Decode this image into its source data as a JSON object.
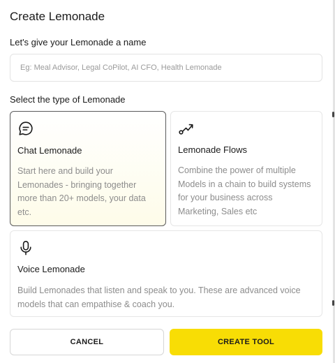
{
  "dialog": {
    "title": "Create Lemonade"
  },
  "name_section": {
    "label": "Let's give your Lemonade a name",
    "input_value": "",
    "placeholder": "Eg: Meal Advisor, Legal CoPilot, AI CFO, Health Lemonade"
  },
  "type_section": {
    "label": "Select the type of Lemonade",
    "selected": "Chat Lemonade",
    "options": [
      {
        "icon": "chat-bubble-icon",
        "title": "Chat Lemonade",
        "description": "Start here and build your Lemonades - bringing together more than 20+ models, your data etc."
      },
      {
        "icon": "flow-arrow-icon",
        "title": "Lemonade Flows",
        "description": "Combine the power of multiple Models in a chain to build systems for your business across Marketing, Sales etc"
      },
      {
        "icon": "microphone-icon",
        "title": "Voice Lemonade",
        "description": "Build Lemonades that listen and speak to you. These are advanced voice models that can empathise & coach you."
      }
    ]
  },
  "actions": {
    "cancel_label": "CANCEL",
    "create_label": "CREATE TOOL"
  },
  "colors": {
    "accent": "#f8dd05",
    "selected_border": "#5a5a5a",
    "selected_bg_tint": "#fefce9",
    "muted_text": "#8c8c8c"
  }
}
